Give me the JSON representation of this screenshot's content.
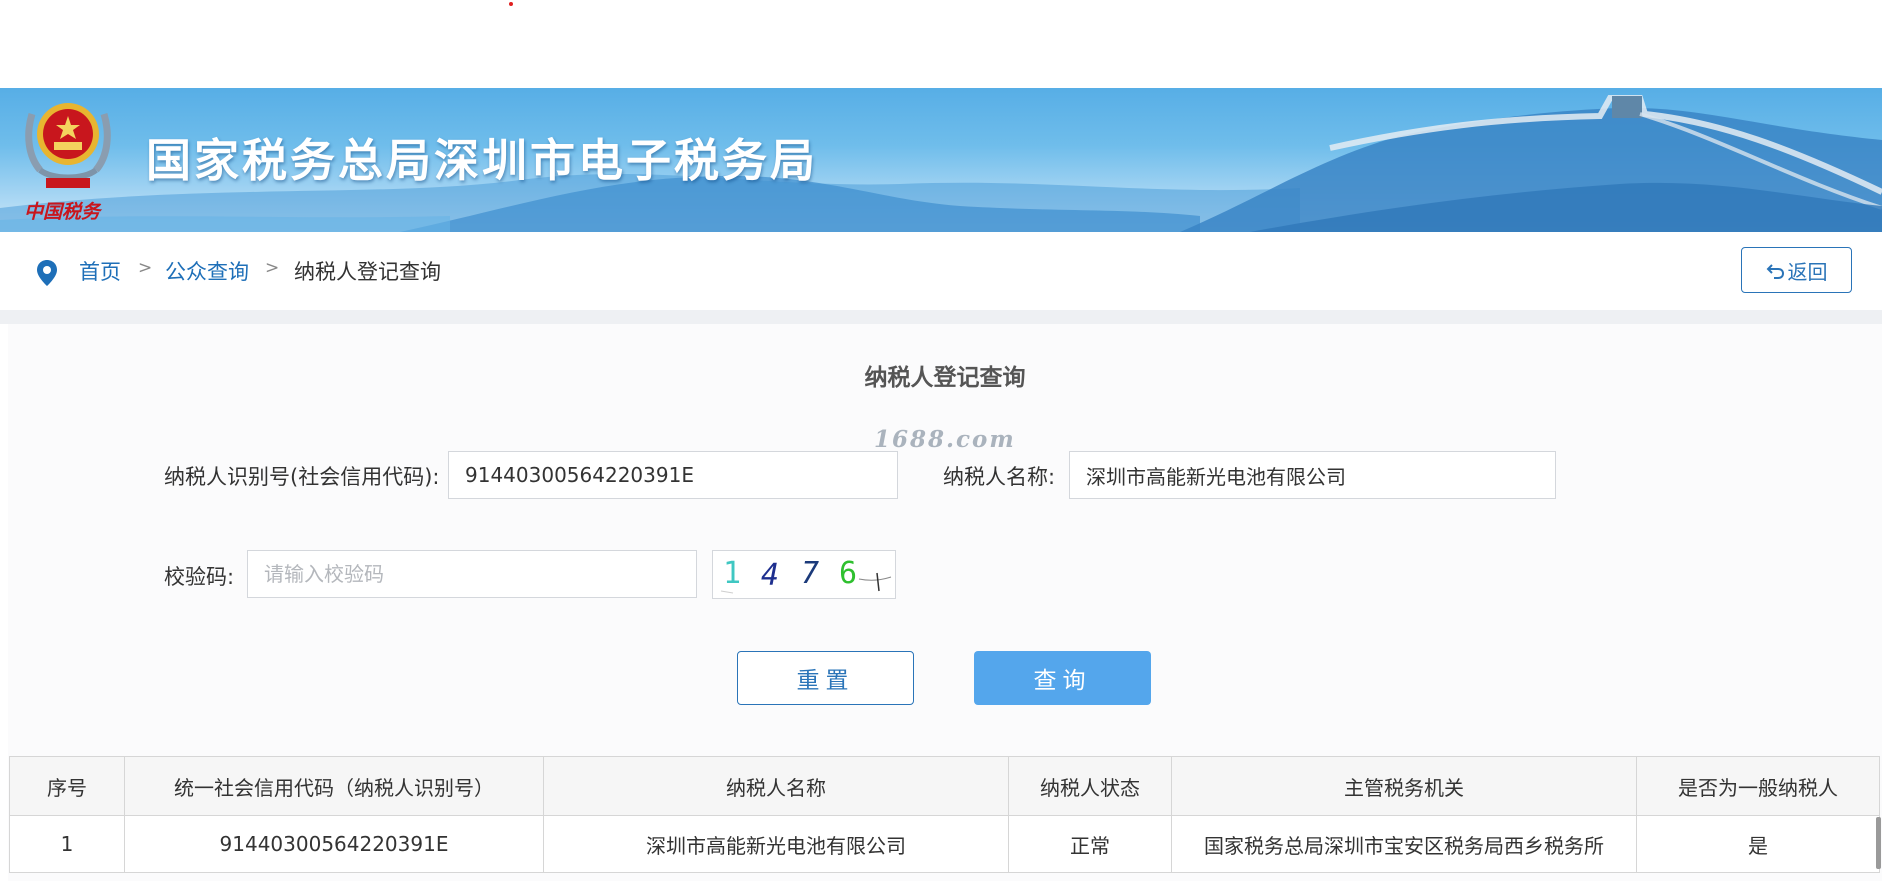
{
  "banner": {
    "title": "国家税务总局深圳市电子税务局",
    "emblem_caption": "中国税务"
  },
  "breadcrumb": {
    "icon": "location-pin-icon",
    "items": [
      "首页",
      "公众查询",
      "纳税人登记查询"
    ],
    "separator": ">"
  },
  "back_button": {
    "icon": "return-arrow-icon",
    "label": "返回"
  },
  "form": {
    "title": "纳税人登记查询",
    "watermark": "1688.com",
    "taxpayer_id_label": "纳税人识别号(社会信用代码):",
    "taxpayer_id_value": "91440300564220391E",
    "taxpayer_name_label": "纳税人名称:",
    "taxpayer_name_value": "深圳市高能新光电池有限公司",
    "captcha_label": "校验码:",
    "captcha_placeholder": "请输入校验码",
    "captcha_text": [
      "1",
      "4",
      "7",
      "6"
    ],
    "reset_label": "重置",
    "query_label": "查询"
  },
  "table": {
    "headers": [
      "序号",
      "统一社会信用代码（纳税人识别号）",
      "纳税人名称",
      "纳税人状态",
      "主管税务机关",
      "是否为一般纳税人"
    ],
    "rows": [
      [
        "1",
        "91440300564220391E",
        "深圳市高能新光电池有限公司",
        "正常",
        "国家税务总局深圳市宝安区税务局西乡税务所",
        "是"
      ]
    ]
  },
  "colors": {
    "link_blue": "#1e6fb8",
    "button_blue": "#54a6ec",
    "border_blue": "#2a74b8",
    "emblem_red": "#c8161d",
    "emblem_gold": "#e8b530"
  }
}
